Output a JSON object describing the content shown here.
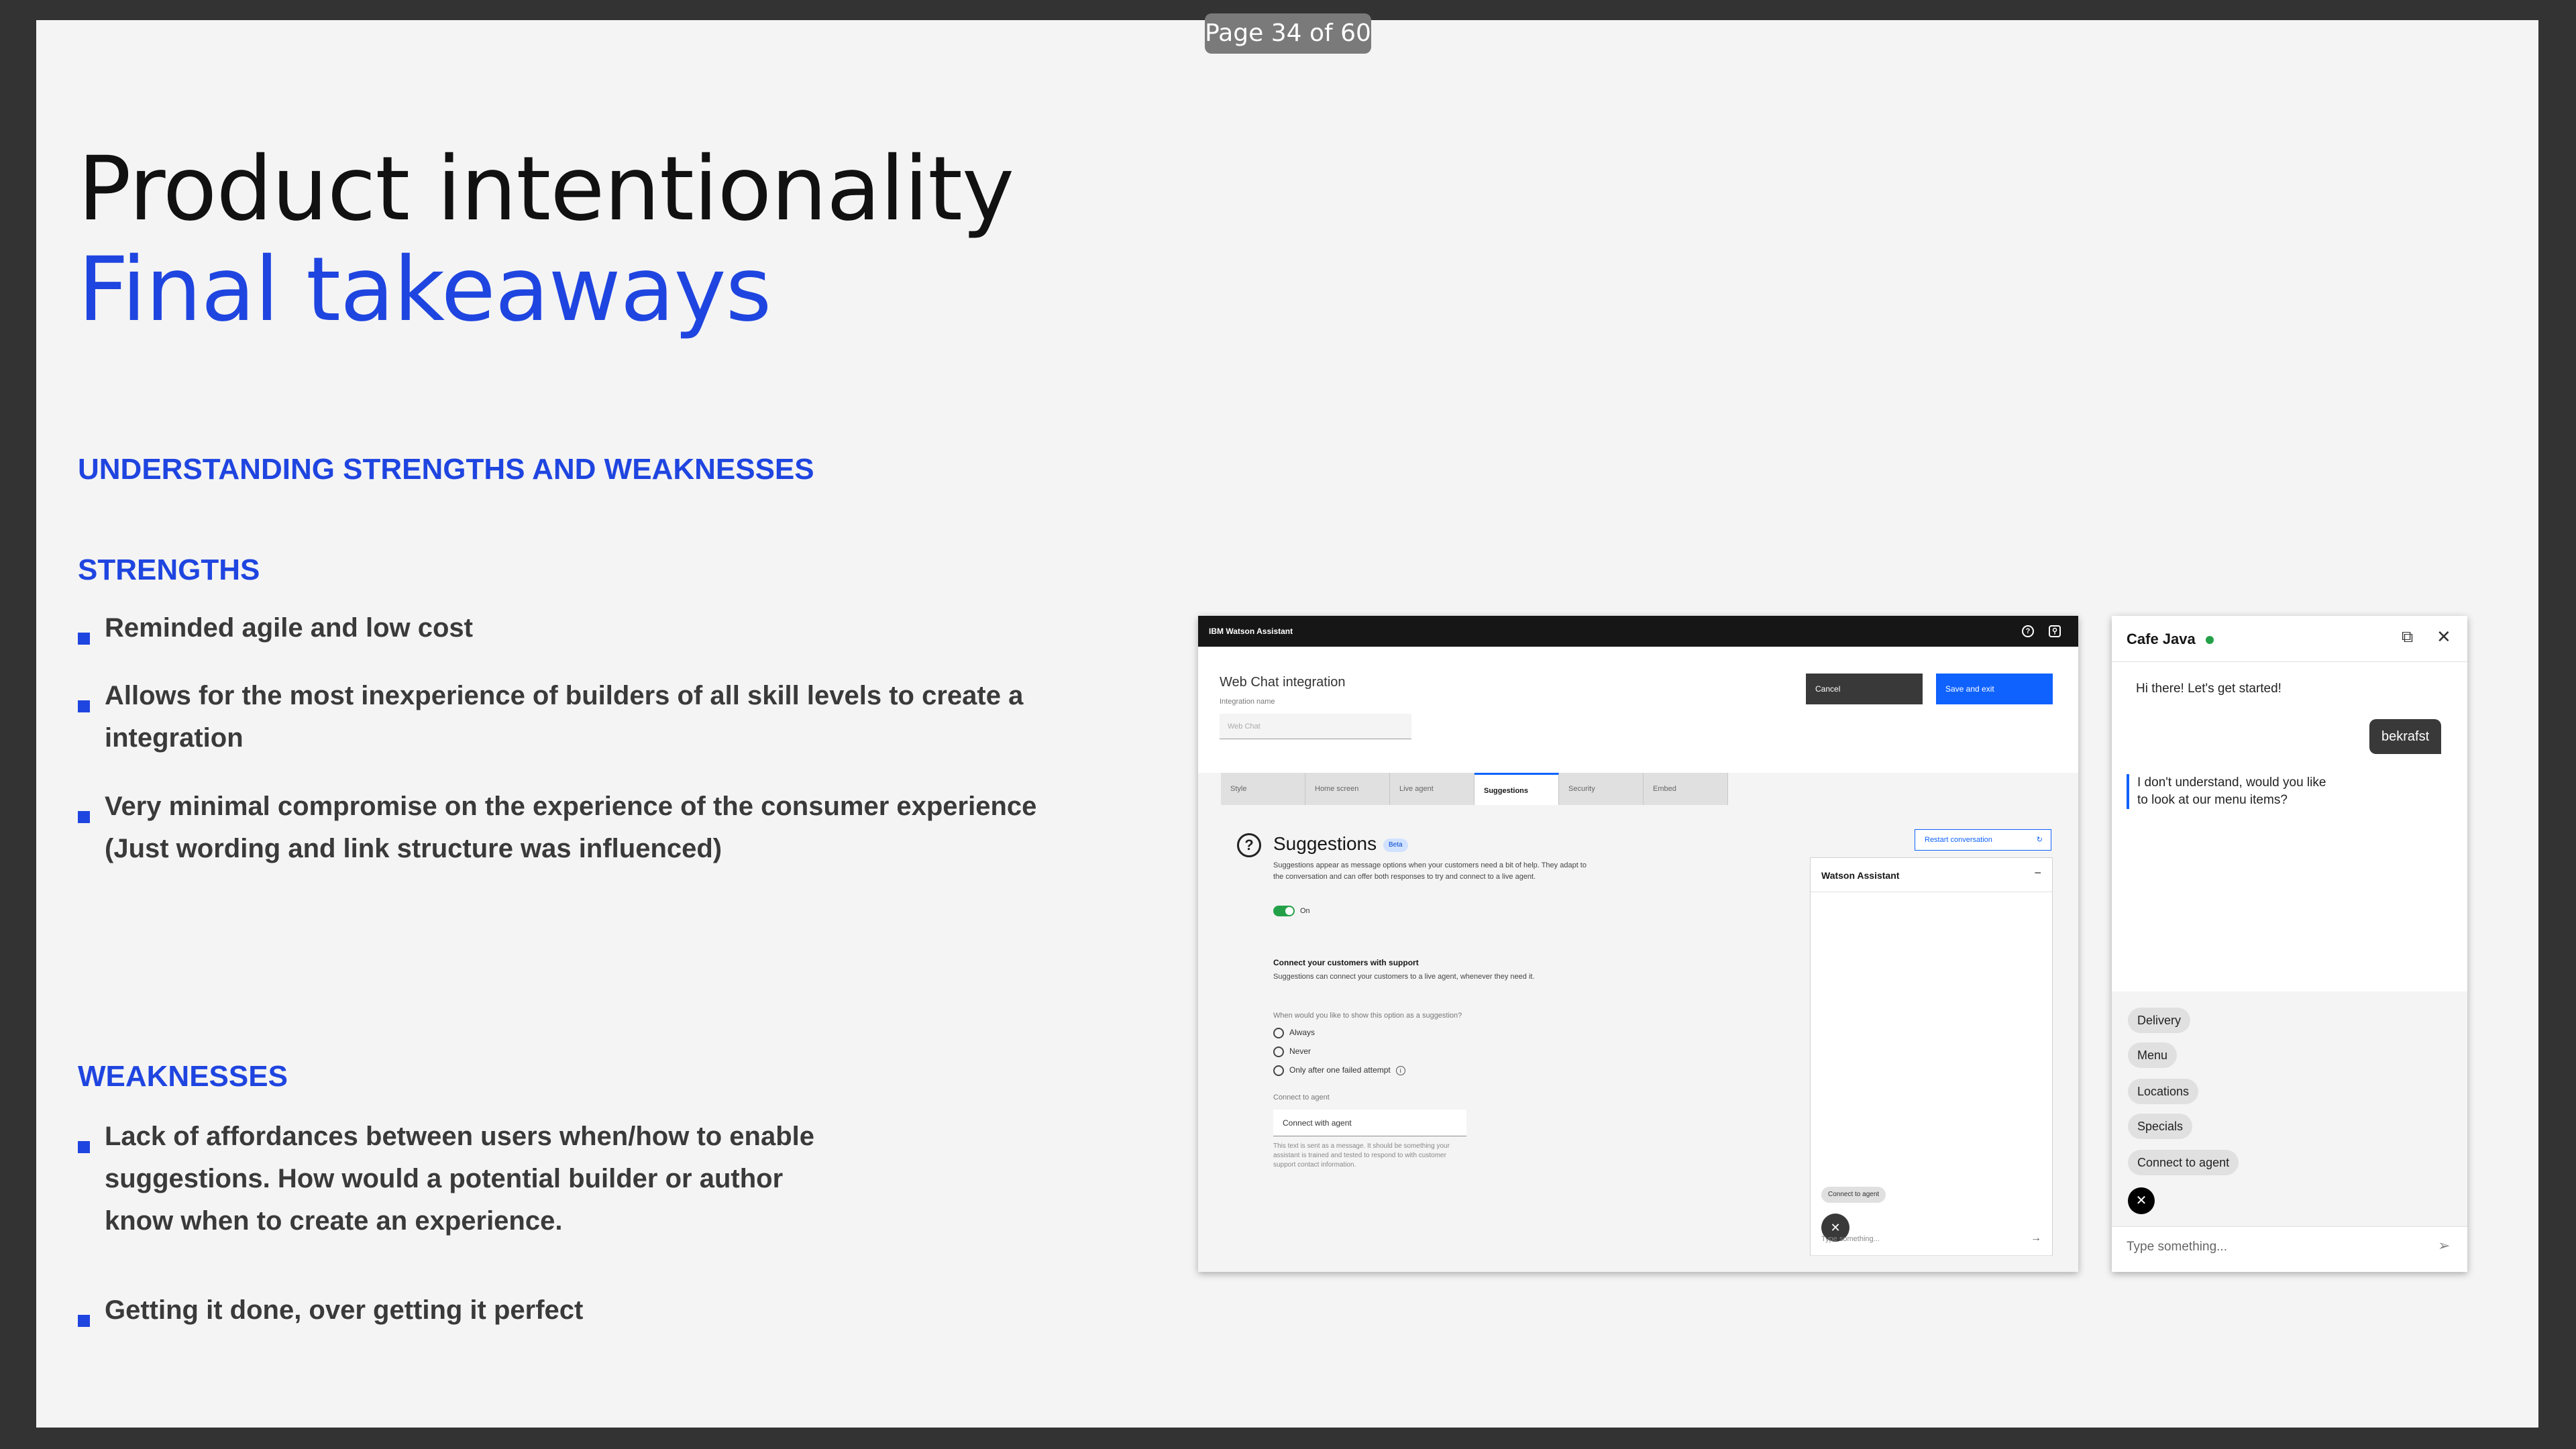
{
  "page_indicator": "Page 34 of 60",
  "title_line1": "Product intentionality",
  "title_line2": "Final takeaways",
  "section_heading": "UNDERSTANDING STRENGTHS AND WEAKNESSES",
  "strengths": {
    "heading": "STRENGTHS",
    "items": [
      "Reminded agile and low cost",
      "Allows for the most inexperience of builders of all skill levels to create a integration",
      "Very minimal compromise on the experience of the consumer experience (Just wording and link structure was influenced)"
    ]
  },
  "weaknesses": {
    "heading": "WEAKNESSES",
    "items": [
      "Lack of affordances between users when/how to enable suggestions. How would a potential builder or author know when to create an experience.",
      "Getting it done, over getting it perfect"
    ]
  },
  "watson": {
    "brand": "IBM Watson Assistant",
    "integration_title": "Web Chat integration",
    "integration_name_label": "Integration name",
    "integration_name_value": "Web Chat",
    "cancel": "Cancel",
    "save": "Save and exit",
    "tabs": [
      "Style",
      "Home screen",
      "Live agent",
      "Suggestions",
      "Security",
      "Embed"
    ],
    "suggestions_title": "Suggestions",
    "beta": "Beta",
    "suggestions_desc": "Suggestions appear as message options when your customers need a bit of help. They adapt to the conversation and can offer both responses to try and connect to a live agent.",
    "toggle_label": "On",
    "connect_heading": "Connect your customers with support",
    "connect_desc": "Suggestions can connect your customers to a live agent, whenever they need it.",
    "when_label": "When would you like to show this option as a suggestion?",
    "radio_options": [
      "Always",
      "Never",
      "Only after one failed attempt"
    ],
    "connect_label": "Connect to agent",
    "connect_value": "Connect with agent",
    "connect_help": "This text is sent as a message. It should be something your assistant is trained and tested to respond to with customer support contact information.",
    "restart": "Restart conversation",
    "preview_title": "Watson Assistant",
    "preview_chip": "Connect to agent",
    "preview_input": "Type something..."
  },
  "cafe": {
    "title": "Cafe Java",
    "greeting": "Hi there! Let's get started!",
    "user_msg": "bekrafst",
    "bot_msg": "I don't understand, would you like to look at our menu items?",
    "chips": [
      "Delivery",
      "Menu",
      "Locations",
      "Specials",
      "Connect to agent"
    ],
    "input_placeholder": "Type something...",
    "status_color": "#24a148"
  }
}
